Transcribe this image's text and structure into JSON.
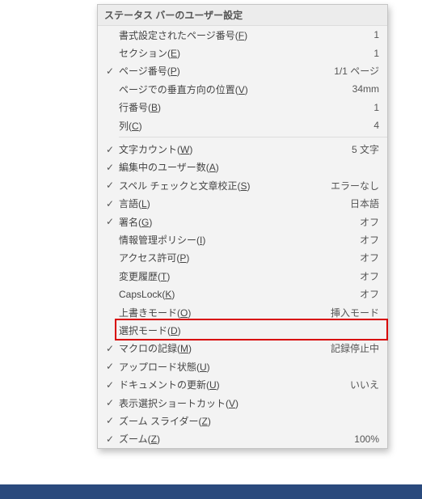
{
  "header": "ステータス バーのユーザー設定",
  "highlight_index": 16,
  "groups": [
    {
      "items": [
        {
          "checked": false,
          "label": "書式設定されたページ番号",
          "accesskey": "F",
          "value": "1"
        },
        {
          "checked": false,
          "label": "セクション",
          "accesskey": "E",
          "value": "1"
        },
        {
          "checked": true,
          "label": "ページ番号",
          "accesskey": "P",
          "value": "1/1 ページ"
        },
        {
          "checked": false,
          "label": "ページでの垂直方向の位置",
          "accesskey": "V",
          "value": "34mm"
        },
        {
          "checked": false,
          "label": "行番号",
          "accesskey": "B",
          "value": "1"
        },
        {
          "checked": false,
          "label": "列",
          "accesskey": "C",
          "value": "4"
        }
      ]
    },
    {
      "items": [
        {
          "checked": true,
          "label": "文字カウント",
          "accesskey": "W",
          "value": "5 文字"
        },
        {
          "checked": true,
          "label": "編集中のユーザー数",
          "accesskey": "A",
          "value": ""
        },
        {
          "checked": true,
          "label": "スペル チェックと文章校正",
          "accesskey": "S",
          "value": "エラーなし"
        },
        {
          "checked": true,
          "label": "言語",
          "accesskey": "L",
          "value": "日本語"
        },
        {
          "checked": true,
          "label": "署名",
          "accesskey": "G",
          "value": "オフ"
        },
        {
          "checked": false,
          "label": "情報管理ポリシー",
          "accesskey": "I",
          "value": "オフ"
        },
        {
          "checked": false,
          "label": "アクセス許可",
          "accesskey": "P",
          "value": "オフ"
        },
        {
          "checked": false,
          "label": "変更履歴",
          "accesskey": "T",
          "value": "オフ"
        },
        {
          "checked": false,
          "label": "CapsLock",
          "accesskey": "K",
          "value": "オフ"
        },
        {
          "checked": false,
          "label": "上書きモード",
          "accesskey": "O",
          "value": "挿入モード"
        },
        {
          "checked": false,
          "label": "選択モード",
          "accesskey": "D",
          "value": ""
        },
        {
          "checked": true,
          "label": "マクロの記録",
          "accesskey": "M",
          "value": "記録停止中"
        },
        {
          "checked": true,
          "label": "アップロード状態",
          "accesskey": "U",
          "value": ""
        },
        {
          "checked": true,
          "label": "ドキュメントの更新",
          "accesskey": "U",
          "value": "いいえ"
        },
        {
          "checked": true,
          "label": "表示選択ショートカット",
          "accesskey": "V",
          "value": ""
        },
        {
          "checked": true,
          "label": "ズーム スライダー",
          "accesskey": "Z",
          "value": ""
        },
        {
          "checked": true,
          "label": "ズーム",
          "accesskey": "Z",
          "value": "100%"
        }
      ]
    }
  ]
}
